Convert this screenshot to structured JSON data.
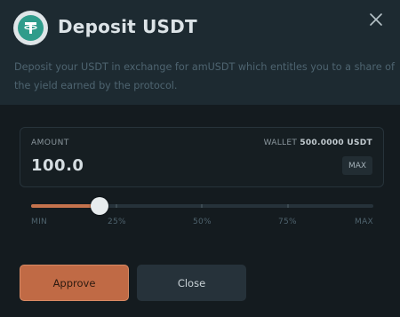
{
  "modal": {
    "title": "Deposit USDT",
    "description": "Deposit your USDT in exchange for amUSDT which entitles you to a share of the yield earned by the protocol.",
    "token_icon": "tether-icon"
  },
  "amount": {
    "label": "AMOUNT",
    "wallet_prefix": "WALLET",
    "wallet_balance": "500.0000 USDT",
    "value": "100.0",
    "max_label": "MAX"
  },
  "slider": {
    "fraction": 0.2,
    "ticks": [
      "MIN",
      "25%",
      "50%",
      "75%",
      "MAX"
    ]
  },
  "buttons": {
    "approve_label": "Approve",
    "close_label": "Close"
  },
  "colors": {
    "accent": "#c06a45",
    "token": "#2f9c8b"
  }
}
